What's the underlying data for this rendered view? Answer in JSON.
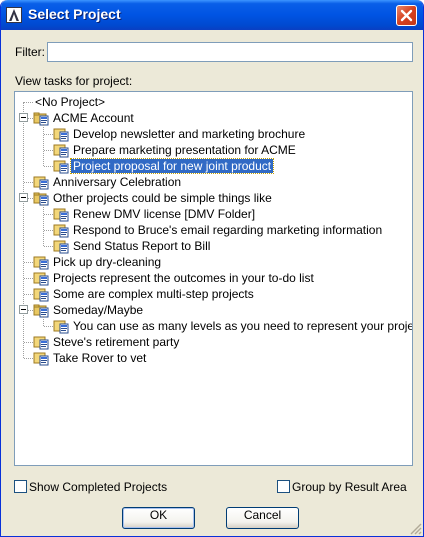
{
  "window": {
    "title": "Select Project"
  },
  "filter": {
    "label": "Filter:",
    "value": ""
  },
  "tree": {
    "label": "View tasks for project:",
    "items": [
      {
        "label": "<No Project>",
        "level": 0,
        "icon": "none",
        "expanded": null,
        "selected": false
      },
      {
        "label": "ACME Account",
        "level": 0,
        "icon": "project-folder",
        "expanded": true,
        "selected": false
      },
      {
        "label": "Develop newsletter and marketing brochure",
        "level": 1,
        "icon": "project",
        "expanded": null,
        "selected": false
      },
      {
        "label": "Prepare marketing presentation for ACME",
        "level": 1,
        "icon": "project",
        "expanded": null,
        "selected": false
      },
      {
        "label": "Project proposal for new joint product",
        "level": 1,
        "icon": "project",
        "expanded": null,
        "selected": true
      },
      {
        "label": "Anniversary Celebration",
        "level": 0,
        "icon": "project",
        "expanded": null,
        "selected": false
      },
      {
        "label": "Other projects could be simple things like",
        "level": 0,
        "icon": "project-folder",
        "expanded": true,
        "selected": false
      },
      {
        "label": "Renew DMV license [DMV Folder]",
        "level": 1,
        "icon": "project",
        "expanded": null,
        "selected": false
      },
      {
        "label": "Respond to Bruce's email regarding marketing information",
        "level": 1,
        "icon": "project",
        "expanded": null,
        "selected": false
      },
      {
        "label": "Send Status Report to Bill",
        "level": 1,
        "icon": "project",
        "expanded": null,
        "selected": false
      },
      {
        "label": "Pick up dry-cleaning",
        "level": 0,
        "icon": "project",
        "expanded": null,
        "selected": false
      },
      {
        "label": "Projects represent the outcomes in your to-do list",
        "level": 0,
        "icon": "project",
        "expanded": null,
        "selected": false
      },
      {
        "label": "Some are complex multi-step projects",
        "level": 0,
        "icon": "project",
        "expanded": null,
        "selected": false
      },
      {
        "label": "Someday/Maybe",
        "level": 0,
        "icon": "project-folder",
        "expanded": true,
        "selected": false
      },
      {
        "label": "You can use as many levels as you need to represent your projects",
        "level": 1,
        "icon": "project",
        "expanded": null,
        "selected": false
      },
      {
        "label": "Steve's retirement party",
        "level": 0,
        "icon": "project",
        "expanded": null,
        "selected": false
      },
      {
        "label": "Take Rover to vet",
        "level": 0,
        "icon": "project",
        "expanded": null,
        "selected": false
      }
    ]
  },
  "options": {
    "show_completed": {
      "label": "Show Completed Projects",
      "checked": false
    },
    "group_by_area": {
      "label": "Group by Result Area",
      "checked": false
    }
  },
  "buttons": {
    "ok": "OK",
    "cancel": "Cancel"
  },
  "colors": {
    "titlebar": "#0054e3",
    "selection": "#316ac5",
    "dialog_bg": "#ece9d8"
  }
}
